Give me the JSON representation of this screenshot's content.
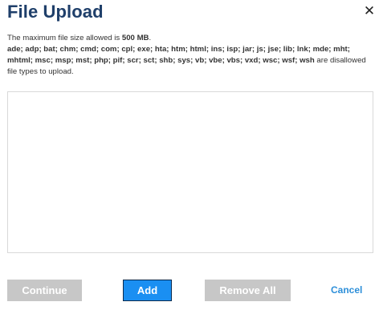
{
  "dialog": {
    "title": "File Upload",
    "close_icon": "close-icon",
    "info": {
      "max_size_prefix": "The maximum file size allowed is ",
      "max_size_value": "500 MB",
      "max_size_suffix": ".",
      "disallowed_extensions": "ade; adp; bat; chm; cmd; com; cpl; exe; hta; htm; html; ins; isp; jar; js; jse; lib; lnk; mde; mht; mhtml; msc; msp; mst; php; pif; scr; sct; shb; sys; vb; vbe; vbs; vxd; wsc; wsf; wsh",
      "disallowed_suffix": " are disallowed file types to upload."
    },
    "buttons": {
      "continue_label": "Continue",
      "add_label": "Add",
      "remove_all_label": "Remove All",
      "cancel_label": "Cancel"
    }
  },
  "colors": {
    "title": "#1f3f6a",
    "add_button": "#1a8ff2",
    "disabled_button": "#c7c7c7",
    "cancel_link": "#2d8fd9"
  }
}
